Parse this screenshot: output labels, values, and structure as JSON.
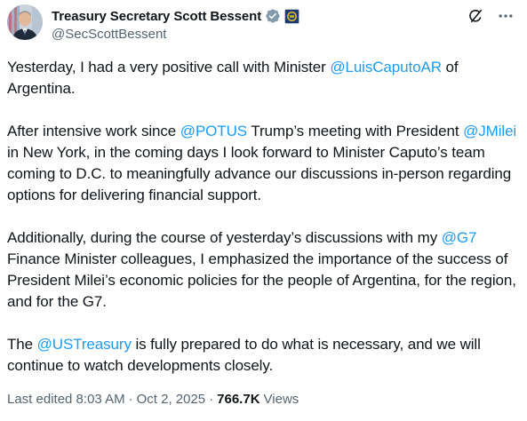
{
  "author": {
    "display_name": "Treasury Secretary Scott Bessent",
    "handle": "@SecScottBessent",
    "verified_badge_color": "#829aab",
    "affiliate_badge": "us-treasury-seal-icon"
  },
  "colors": {
    "mention": "#1d9bf0",
    "secondary_text": "#536471",
    "primary_text": "#0f1419"
  },
  "paragraphs": [
    [
      {
        "text": "Yesterday, I had a very positive call with Minister "
      },
      {
        "text": "@LuisCaputoAR",
        "mention": true
      },
      {
        "text": " of Argentina."
      }
    ],
    [
      {
        "text": "After intensive work since "
      },
      {
        "text": "@POTUS",
        "mention": true
      },
      {
        "text": " Trump’s meeting with President "
      },
      {
        "text": "@JMilei",
        "mention": true
      },
      {
        "text": " in New York, in the coming days I look forward to Minister Caputo’s team coming to D.C. to meaningfully advance our discussions in-person regarding options for delivering financial support."
      }
    ],
    [
      {
        "text": "Additionally, during the course of yesterday’s discussions with my "
      },
      {
        "text": "@G7",
        "mention": true
      },
      {
        "text": " Finance Minister colleagues, I emphasized the importance of the success of President Milei’s economic policies for the people of Argentina, for the region, and for the G7."
      }
    ],
    [
      {
        "text": "The "
      },
      {
        "text": "@USTreasury",
        "mention": true
      },
      {
        "text": " is fully prepared to do what is necessary, and we will continue to watch developments closely."
      }
    ]
  ],
  "meta": {
    "edited_time": "Last edited 8:03 AM",
    "separator": "·",
    "date": "Oct 2, 2025",
    "views_count": "766.7K",
    "views_label": "Views"
  },
  "icons": {
    "grok": "grok-icon",
    "more": "more-options-icon"
  }
}
